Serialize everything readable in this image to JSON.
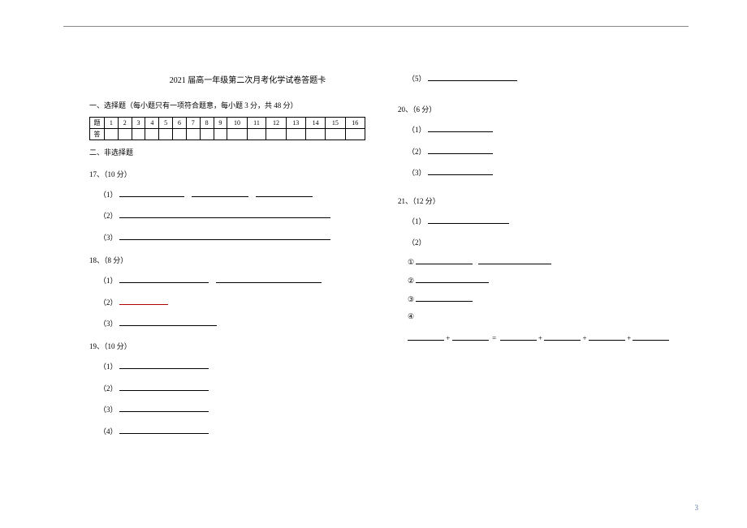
{
  "title": "2021 届高一年级第二次月考化学试卷答题卡",
  "section1": "一、选择题（每小题只有一项符合题意，每小题 3 分，共 48 分）",
  "table_row_label": "题",
  "table_answer_label": "答",
  "cols": [
    "1",
    "2",
    "3",
    "4",
    "5",
    "6",
    "7",
    "8",
    "9",
    "10",
    "11",
    "12",
    "13",
    "14",
    "15",
    "16"
  ],
  "section2": "二、非选择题",
  "q17": "17、（10 分）",
  "q18": "18、（8 分）",
  "q19": "19、（10 分）",
  "q20": "20、（6 分）",
  "q21": "21、（12 分）",
  "p1": "（1）",
  "p2": "（2）",
  "p3": "（3）",
  "p4": "（4）",
  "p5": "（5）",
  "c1": "①",
  "c2": "②",
  "c3": "③",
  "c4": "④",
  "plus": "+",
  "eq": "=",
  "page_number": "3"
}
